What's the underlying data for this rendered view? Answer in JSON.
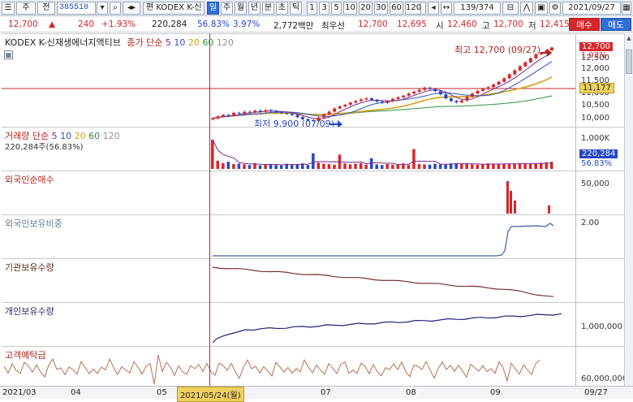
{
  "toolbar": {
    "market": "주",
    "type": "전",
    "code": "385510",
    "edit_label": "편",
    "name": "KODEX K-신",
    "periods": [
      "일",
      "주",
      "월",
      "년",
      "분",
      "초",
      "틱"
    ],
    "active_period": "일",
    "intervals": [
      "1",
      "3",
      "5",
      "10",
      "20",
      "30",
      "60",
      "120"
    ],
    "page_counter": "139/374",
    "date": "2021/09/27"
  },
  "quote": {
    "price": "12,700",
    "change": "240",
    "change_pct": "+1.93%",
    "volume": "220,284",
    "turnover_ratio": "56.83%",
    "ratio2": "3.97%",
    "amount": "2,772백만",
    "best_ask_label": "최우선",
    "best_ask": "12,700",
    "best_bid": "12,695",
    "open_label": "시",
    "open": "12,460",
    "high_label": "고",
    "high": "12,700",
    "low_label": "저",
    "low": "12,415"
  },
  "actions": {
    "buy": "매수",
    "sell": "매도"
  },
  "price_panel": {
    "title": "KODEX K-신재생에너지액티브",
    "ma_prefix": "종가 단순",
    "ma_periods": [
      "5",
      "10",
      "20",
      "60",
      "120"
    ],
    "ma_colors": [
      "#7d2b8c",
      "#2a52c6",
      "#d4a017",
      "#2f8f46",
      "#8f8f8f"
    ],
    "high_note": "최고 12,700 (09/27)",
    "low_note": "최저 9,900 (07/09)",
    "ticks": [
      "12,500",
      "12,000",
      "11,500",
      "11,000",
      "10,500",
      "10,000"
    ],
    "current_price_tag": "12,700",
    "current_pct_tag": "1.93%",
    "crosshair_value": "11,177"
  },
  "volume_panel": {
    "title": "거래량 단순",
    "ma_periods": [
      "5",
      "10",
      "20",
      "60",
      "120"
    ],
    "sub": "220,284주(56.83%)",
    "tick": "1,000K",
    "volume_tag": "220,284",
    "pct_tag": "56.83%"
  },
  "foreign_net_panel": {
    "title": "외국인순매수",
    "tick": "50,000"
  },
  "foreign_hold_panel": {
    "title": "외국인보유비중",
    "tick": "2.00"
  },
  "institution_panel": {
    "title": "기관보유수량"
  },
  "individual_panel": {
    "title": "개인보유수량",
    "tick": "1,000,000"
  },
  "deposit_panel": {
    "title": "고객예탁금",
    "tick": "60,000,000"
  },
  "xaxis": {
    "labels": [
      "2021/03",
      "04",
      "05",
      "07",
      "08",
      "09",
      "09/27"
    ],
    "crosshair_date": "2021/05/24(월)"
  },
  "colors": {
    "up": "#d8262b",
    "down": "#2547c9",
    "crosshair": "#c62424",
    "accent": "#2f6fd6"
  },
  "chart_data": {
    "type": "candlestick",
    "title": "KODEX K-신재생에너지액티브",
    "period_label": "2021/05/24 - 2021/09/27",
    "high": {
      "value": 12700,
      "date": "09/27"
    },
    "low": {
      "value": 9900,
      "date": "07/09"
    },
    "ylim": [
      9800,
      12900
    ],
    "close_series": [
      10050,
      10120,
      10180,
      10150,
      10260,
      10230,
      10300,
      10280,
      10340,
      10300,
      10360,
      10330,
      10280,
      10250,
      10220,
      10180,
      10100,
      10020,
      9980,
      9950,
      10080,
      10200,
      10300,
      10420,
      10500,
      10560,
      10640,
      10700,
      10760,
      10800,
      10740,
      10680,
      10630,
      10700,
      10780,
      10840,
      10900,
      10980,
      11050,
      11120,
      11200,
      11150,
      11070,
      10950,
      10800,
      10700,
      10650,
      10720,
      10860,
      10980,
      11080,
      11150,
      11220,
      11320,
      11420,
      11550,
      11700,
      11850,
      12000,
      12150,
      12300,
      12450,
      12500,
      12600,
      12700
    ],
    "volume_series": [
      900,
      250,
      180,
      220,
      150,
      160,
      140,
      120,
      180,
      110,
      130,
      150,
      120,
      110,
      160,
      130,
      150,
      170,
      120,
      480,
      190,
      160,
      150,
      130,
      440,
      170,
      140,
      160,
      180,
      130,
      330,
      140,
      120,
      150,
      130,
      140,
      170,
      120,
      610,
      150,
      140,
      130,
      160,
      140,
      150,
      170,
      180,
      160,
      150,
      140,
      130,
      150,
      170,
      160,
      140,
      150,
      160,
      170,
      180,
      160,
      150,
      170,
      190,
      200,
      220
    ]
  }
}
